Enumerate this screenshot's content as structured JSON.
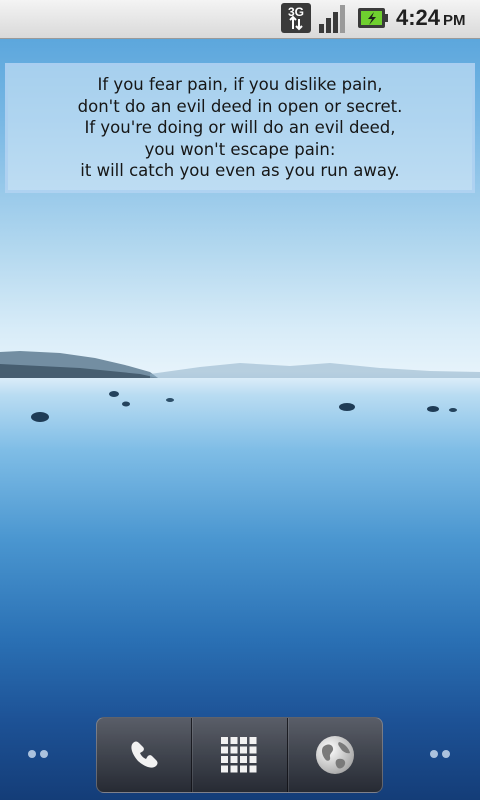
{
  "status_bar": {
    "network_type": "3G",
    "icons": [
      "network-3g-icon",
      "signal-strength-icon",
      "battery-charging-icon"
    ],
    "time": "4:24",
    "ampm": "PM"
  },
  "quote_widget": {
    "lines": [
      "If you fear pain, if you dislike pain,",
      "don't do an evil deed in open or secret.",
      "If you're doing or will do an evil deed,",
      "you won't escape pain:",
      "it will catch you even as you run away."
    ]
  },
  "dock": {
    "buttons": [
      {
        "name": "phone",
        "icon": "phone-icon"
      },
      {
        "name": "app-drawer",
        "icon": "app-grid-icon"
      },
      {
        "name": "browser",
        "icon": "globe-icon"
      }
    ]
  },
  "colors": {
    "status_bar_bg": "#e4e4e4",
    "sky_top": "#4f9fd9",
    "horizon": "#e6f3fb",
    "water_bottom": "#143d78"
  }
}
